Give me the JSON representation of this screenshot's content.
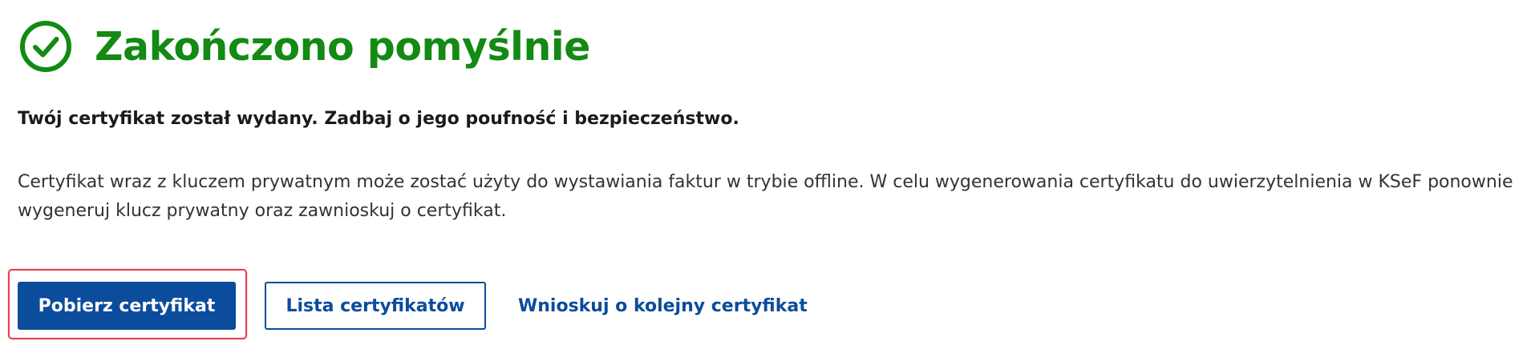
{
  "header": {
    "title": "Zakończono pomyślnie",
    "icon": "check-circle-icon",
    "accent_color": "#128a14"
  },
  "content": {
    "lead": "Twój certyfikat został wydany. Zadbaj o jego poufność i bezpieczeństwo.",
    "description": "Certyfikat wraz z kluczem prywatnym może zostać użyty do wystawiania faktur w trybie offline. W celu wygenerowania certyfikatu do uwierzytelnienia w KSeF ponownie wygeneruj klucz prywatny oraz zawnioskuj o certyfikat."
  },
  "actions": {
    "download_label": "Pobierz certyfikat",
    "list_label": "Lista certyfikatów",
    "request_label": "Wnioskuj o kolejny certyfikat",
    "primary_color": "#0b4c9c",
    "focus_ring_color": "#e0414d"
  }
}
